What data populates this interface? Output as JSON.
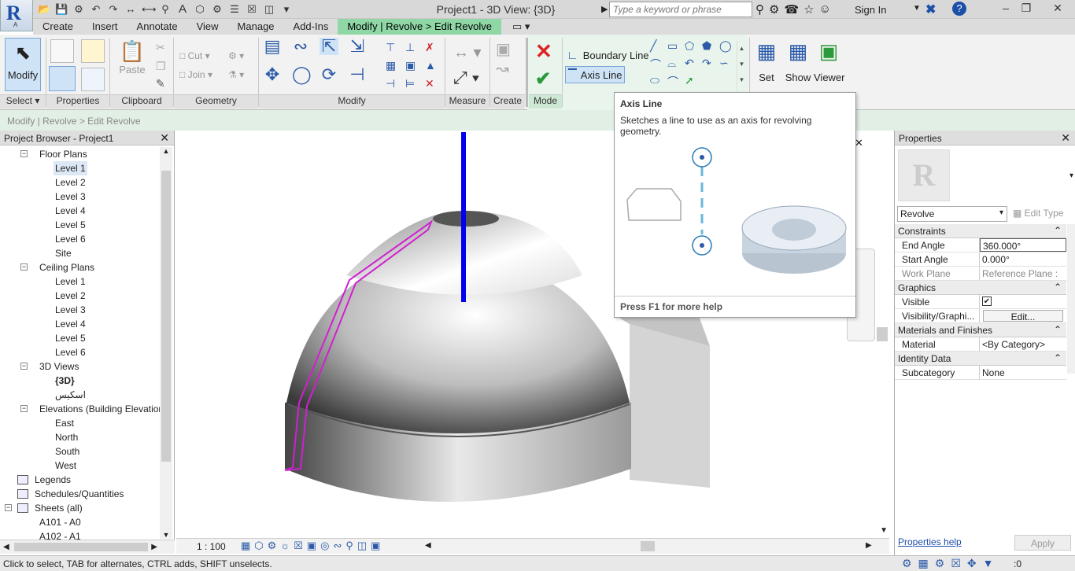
{
  "titlebar": {
    "title": "Project1 - 3D View: {3D}",
    "search_placeholder": "Type a keyword or phrase",
    "sign_in": "Sign In"
  },
  "tabs": [
    "Create",
    "Insert",
    "Annotate",
    "View",
    "Manage",
    "Add-Ins",
    "Modify | Revolve > Edit Revolve"
  ],
  "ribbon": {
    "modify_label": "Modify",
    "paste_label": "Paste",
    "cut_label": "Cut",
    "join_label": "Join",
    "boundary_line": "Boundary Line",
    "axis_line": "Axis Line",
    "set_label": "Set",
    "show_label": "Show",
    "viewer_label": "Viewer",
    "panels": [
      "Select",
      "Properties",
      "Clipboard",
      "Geometry",
      "Modify",
      "Measure",
      "Create",
      "Mode"
    ]
  },
  "tooltip": {
    "title": "Axis Line",
    "description": "Sketches a line to use as an axis for revolving geometry.",
    "help": "Press F1 for more help"
  },
  "breadcrumb": "Modify | Revolve > Edit Revolve",
  "project_browser": {
    "title": "Project Browser - Project1",
    "items": [
      {
        "label": "Floor Plans",
        "level": 1,
        "toggle": "−"
      },
      {
        "label": "Level 1",
        "level": 2,
        "selected": true
      },
      {
        "label": "Level 2",
        "level": 2
      },
      {
        "label": "Level 3",
        "level": 2
      },
      {
        "label": "Level 4",
        "level": 2
      },
      {
        "label": "Level 5",
        "level": 2
      },
      {
        "label": "Level 6",
        "level": 2
      },
      {
        "label": "Site",
        "level": 2
      },
      {
        "label": "Ceiling Plans",
        "level": 1,
        "toggle": "−"
      },
      {
        "label": "Level 1",
        "level": 2
      },
      {
        "label": "Level 2",
        "level": 2
      },
      {
        "label": "Level 3",
        "level": 2
      },
      {
        "label": "Level 4",
        "level": 2
      },
      {
        "label": "Level 5",
        "level": 2
      },
      {
        "label": "Level 6",
        "level": 2
      },
      {
        "label": "3D Views",
        "level": 1,
        "toggle": "−"
      },
      {
        "label": "{3D}",
        "level": 2,
        "bold": true
      },
      {
        "label": "اسكيس",
        "level": 2
      },
      {
        "label": "Elevations (Building Elevation",
        "level": 1,
        "toggle": "−"
      },
      {
        "label": "East",
        "level": 2
      },
      {
        "label": "North",
        "level": 2
      },
      {
        "label": "South",
        "level": 2
      },
      {
        "label": "West",
        "level": 2
      },
      {
        "label": "Legends",
        "level": 0,
        "icon": true
      },
      {
        "label": "Schedules/Quantities",
        "level": 0,
        "icon": true
      },
      {
        "label": "Sheets (all)",
        "level": 0,
        "icon": true,
        "toggle": "−"
      },
      {
        "label": "A101 - A0",
        "level": 1
      },
      {
        "label": "A102 - A1",
        "level": 1
      }
    ]
  },
  "view": {
    "scale": "1 : 100"
  },
  "properties": {
    "title": "Properties",
    "type_selector": "Revolve",
    "edit_type": "Edit Type",
    "groups": [
      {
        "name": "Constraints",
        "rows": [
          {
            "k": "End Angle",
            "v": "360.000°"
          },
          {
            "k": "Start Angle",
            "v": "0.000°"
          },
          {
            "k": "Work Plane",
            "v": "Reference Plane : ...",
            "grey": true
          }
        ]
      },
      {
        "name": "Graphics",
        "rows": [
          {
            "k": "Visible",
            "v": "✔"
          },
          {
            "k": "Visibility/Graphi...",
            "v": "Edit..."
          }
        ]
      },
      {
        "name": "Materials and Finishes",
        "rows": [
          {
            "k": "Material",
            "v": "<By Category>"
          }
        ]
      },
      {
        "name": "Identity Data",
        "rows": [
          {
            "k": "Subcategory",
            "v": "None"
          }
        ]
      }
    ],
    "help_link": "Properties help",
    "apply": "Apply"
  },
  "status": {
    "text": "Click to select, TAB for alternates, CTRL adds, SHIFT unselects.",
    "filter_count": ":0"
  },
  "colors": {
    "context_tab": "#8fd8a6",
    "axis": "#0000ee",
    "sketch": "#d020d0"
  }
}
